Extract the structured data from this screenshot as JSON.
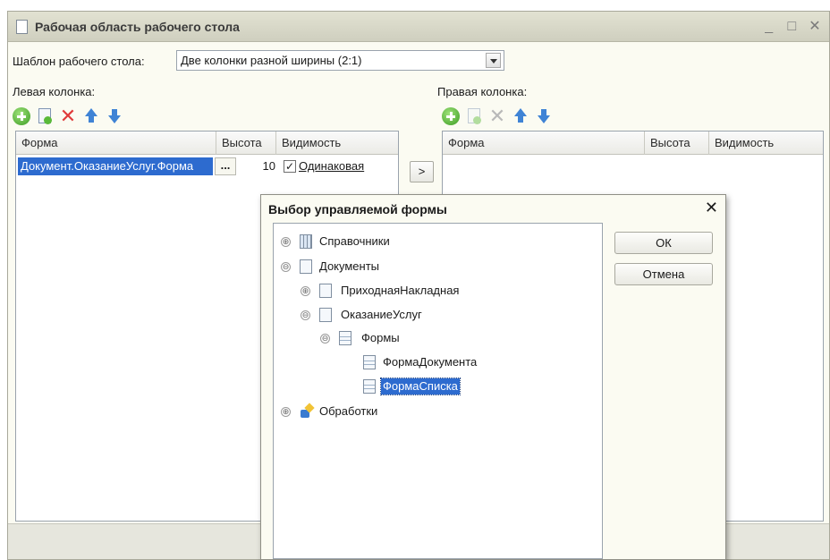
{
  "window": {
    "title": "Рабочая область рабочего стола",
    "controls": {
      "minimize": "_",
      "maximize": "□",
      "close": "✕"
    }
  },
  "template": {
    "label": "Шаблон рабочего стола:",
    "value": "Две колонки разной ширины (2:1)"
  },
  "left_column": {
    "label": "Левая колонка:",
    "headers": [
      "Форма",
      "Высота",
      "Видимость"
    ],
    "rows": [
      {
        "form": "Документ.ОказаниеУслуг.Форма",
        "height": "10",
        "checked": "✓",
        "visibility": "Одинаковая",
        "ellipsis": "..."
      }
    ]
  },
  "move_button": ">",
  "right_column": {
    "label": "Правая колонка:",
    "headers": [
      "Форма",
      "Высота",
      "Видимость"
    ]
  },
  "toolbar_icons": [
    "plus-icon",
    "copy-icon",
    "delete-icon",
    "move-up-icon",
    "move-down-icon"
  ],
  "dialog": {
    "title": "Выбор управляемой формы",
    "close": "✕",
    "ok": "ОК",
    "cancel": "Отмена",
    "tree": [
      {
        "label": "Справочники",
        "expander": "⊕",
        "icon": "catalog-icon"
      },
      {
        "label": "Документы",
        "expander": "⊖",
        "icon": "document-icon"
      },
      {
        "label": "ПриходнаяНакладная",
        "expander": "⊕",
        "icon": "document-icon"
      },
      {
        "label": "ОказаниеУслуг",
        "expander": "⊖",
        "icon": "document-icon"
      },
      {
        "label": "Формы",
        "expander": "⊖",
        "icon": "forms-icon"
      },
      {
        "label": "ФормаДокумента",
        "icon": "form-icon"
      },
      {
        "label": "ФормаСписка",
        "icon": "form-icon",
        "selected": true
      },
      {
        "label": "Обработки",
        "expander": "⊕",
        "icon": "processing-icon"
      }
    ]
  },
  "colors": {
    "selection": "#2d6bcf",
    "window_bg": "#fbfbf2",
    "titlebar": "#d6d6c6"
  }
}
